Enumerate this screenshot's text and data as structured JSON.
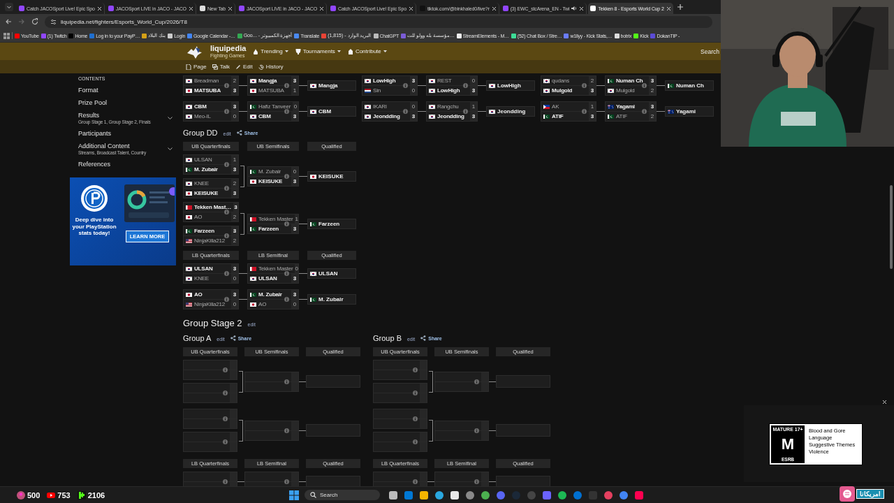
{
  "browser": {
    "tabs": [
      {
        "title": "Catch JACOSport Live! Epic Spo",
        "color": "#9146ff",
        "selected": false,
        "audio": false
      },
      {
        "title": "JACOSport LIVE in JACO - JACO",
        "color": "#9146ff",
        "selected": false,
        "audio": false
      },
      {
        "title": "New Tab",
        "color": "#dddddd",
        "selected": false,
        "audio": false
      },
      {
        "title": "JACOSport LIVE in JACO - JACO",
        "color": "#9146ff",
        "selected": false,
        "audio": false
      },
      {
        "title": "Catch JACOSport Live! Epic Spo",
        "color": "#9146ff",
        "selected": false,
        "audio": false
      },
      {
        "title": "tiktok.com/@binkhaled0/live?r",
        "color": "#111111",
        "selected": false,
        "audio": false
      },
      {
        "title": "(3) EWC_stcArena_EN - Twi",
        "color": "#9146ff",
        "selected": false,
        "audio": true
      },
      {
        "title": "Tekken 8 - Esports World Cup 2",
        "color": "#ffffff",
        "selected": true,
        "audio": false
      }
    ],
    "url": "liquipedia.net/fighters/Esports_World_Cup/2026/T8",
    "bookmarks": [
      {
        "label": "YouTube",
        "color": "#ff0000"
      },
      {
        "label": "(1) Twitch",
        "color": "#9146ff"
      },
      {
        "label": "Home",
        "color": "#000000"
      },
      {
        "label": "Log in to your PayP…",
        "color": "#1f6fd0"
      },
      {
        "label": "بنك البلاد",
        "color": "#d4a017"
      },
      {
        "label": "Login",
        "color": "#cccccc"
      },
      {
        "label": "Google Calendar -…",
        "color": "#4285f4"
      },
      {
        "label": "Goo… - أجهزة الكمبيوتر",
        "color": "#34a853"
      },
      {
        "label": "Translate",
        "color": "#4a8af4"
      },
      {
        "label": "(1,815) - البريد الوارد",
        "color": "#ea4335"
      },
      {
        "label": "ChatGPT",
        "color": "#bbbbbb"
      },
      {
        "label": "مؤسسة بله وولو للت…",
        "color": "#7b5cd6"
      },
      {
        "label": "StreamElements - M…",
        "color": "#eeeeee"
      },
      {
        "label": "(52) Chat Box / Stre…",
        "color": "#3ddc97"
      },
      {
        "label": "w1llyy - Kick Stats,…",
        "color": "#6a7cff"
      },
      {
        "label": "botrix",
        "color": "#dddddd"
      },
      {
        "label": "Kick",
        "color": "#53fc18"
      },
      {
        "label": "DokanTIP -",
        "color": "#5b4bd6"
      }
    ]
  },
  "site": {
    "logo": "liquipedia",
    "subtitle": "Fighting Games",
    "nav": [
      "Trending",
      "Tournaments",
      "Contribute"
    ],
    "search": "Search",
    "actions": [
      "Page",
      "Talk",
      "Edit",
      "History"
    ]
  },
  "sidebar": {
    "heading": "CONTENTS",
    "items": [
      {
        "label": "Format",
        "collapsible": false
      },
      {
        "label": "Prize Pool",
        "collapsible": false
      },
      {
        "label": "Results",
        "sub": "Group Stage 1, Group Stage 2, Finals",
        "collapsible": true
      },
      {
        "label": "Participants",
        "collapsible": false
      },
      {
        "label": "Additional Content",
        "sub": "Streams, Broadcast Talent, Country",
        "collapsible": true
      },
      {
        "label": "References",
        "collapsible": false
      }
    ]
  },
  "ad": {
    "headline": "Deep dive into your PlayStation stats today!",
    "button": "LEARN MORE"
  },
  "top_groups": [
    {
      "blocks": [
        {
          "qf": [
            {
              "players": [
                {
                  "name": "Breadman",
                  "kind": "kr",
                  "score": "2",
                  "winner": false
                },
                {
                  "name": "MATSUBA",
                  "kind": "jp",
                  "score": "3",
                  "winner": true
                }
              ]
            }
          ],
          "sf": {
            "players": [
              {
                "name": "Mangja",
                "kind": "kr",
                "score": "3",
                "winner": true
              },
              {
                "name": "MATSUBA",
                "kind": "jp",
                "score": "1",
                "winner": false
              }
            ]
          },
          "qualified": {
            "name": "Mangja",
            "kind": "kr"
          }
        },
        {
          "qf": [
            {
              "players": [
                {
                  "name": "CBM",
                  "kind": "kr",
                  "score": "3",
                  "winner": true
                },
                {
                  "name": "Meo-IL",
                  "kind": "kr",
                  "score": "0",
                  "winner": false
                }
              ]
            }
          ],
          "sf": {
            "players": [
              {
                "name": "Hafiz Tanveer",
                "kind": "pk",
                "score": "0",
                "winner": false
              },
              {
                "name": "CBM",
                "kind": "kr",
                "score": "3",
                "winner": true
              }
            ]
          },
          "qualified": {
            "name": "CBM",
            "kind": "kr"
          }
        }
      ]
    },
    {
      "blocks": [
        {
          "qf": [
            {
              "players": [
                {
                  "name": "LowHigh",
                  "kind": "kr",
                  "score": "3",
                  "winner": true
                },
                {
                  "name": "Sin",
                  "kind": "nl",
                  "score": "0",
                  "winner": false
                }
              ]
            }
          ],
          "sf": {
            "players": [
              {
                "name": "REST",
                "kind": "kr",
                "score": "0",
                "winner": false
              },
              {
                "name": "LowHigh",
                "kind": "kr",
                "score": "3",
                "winner": true
              }
            ]
          },
          "qualified": {
            "name": "LowHigh",
            "kind": "kr"
          }
        },
        {
          "qf": [
            {
              "players": [
                {
                  "name": "IKARI",
                  "kind": "kr",
                  "score": "0",
                  "winner": false
                },
                {
                  "name": "Jeondding",
                  "kind": "kr",
                  "score": "3",
                  "winner": true
                }
              ]
            }
          ],
          "sf": {
            "players": [
              {
                "name": "Rangchu",
                "kind": "kr",
                "score": "1",
                "winner": false
              },
              {
                "name": "Jeondding",
                "kind": "kr",
                "score": "3",
                "winner": true
              }
            ]
          },
          "qualified": {
            "name": "Jeondding",
            "kind": "kr"
          }
        }
      ]
    },
    {
      "blocks": [
        {
          "qf": [
            {
              "players": [
                {
                  "name": "qudans",
                  "kind": "kr",
                  "score": "2",
                  "winner": false
                },
                {
                  "name": "Mulgold",
                  "kind": "kr",
                  "score": "3",
                  "winner": true
                }
              ]
            }
          ],
          "sf": {
            "players": [
              {
                "name": "Numan Ch",
                "kind": "pk",
                "score": "3",
                "winner": true
              },
              {
                "name": "Mulgold",
                "kind": "kr",
                "score": "2",
                "winner": false
              }
            ]
          },
          "qualified": {
            "name": "Numan Ch",
            "kind": "pk"
          }
        },
        {
          "qf": [
            {
              "players": [
                {
                  "name": "AK",
                  "kind": "ph",
                  "score": "1",
                  "winner": false
                },
                {
                  "name": "ATIF",
                  "kind": "pk",
                  "score": "3",
                  "winner": true
                }
              ]
            }
          ],
          "sf": {
            "players": [
              {
                "name": "Yagami",
                "kind": "au",
                "score": "3",
                "winner": true
              },
              {
                "name": "ATIF",
                "kind": "pk",
                "score": "2",
                "winner": false
              }
            ]
          },
          "qualified": {
            "name": "Yagami",
            "kind": "au"
          }
        }
      ]
    }
  ],
  "group_dd": {
    "title": "Group DD",
    "edit": "edit",
    "share": "Share",
    "kind": "filled",
    "ub_headers": [
      "UB Quarterfinals",
      "UB Semifinals",
      "Qualified"
    ],
    "ub": [
      {
        "qf": [
          {
            "players": [
              {
                "name": "ULSAN",
                "kind": "kr",
                "score": "1",
                "winner": false
              },
              {
                "name": "M. Zubair",
                "kind": "pk",
                "score": "3",
                "winner": true
              }
            ]
          },
          {
            "players": [
              {
                "name": "KNEE",
                "kind": "kr",
                "score": "2",
                "winner": false
              },
              {
                "name": "KEISUKE",
                "kind": "jp",
                "score": "3",
                "winner": true
              }
            ]
          }
        ],
        "sf": {
          "players": [
            {
              "name": "M. Zubair",
              "kind": "pk",
              "score": "0",
              "winner": false
            },
            {
              "name": "KEISUKE",
              "kind": "jp",
              "score": "3",
              "winner": true
            }
          ]
        },
        "qualified": {
          "name": "KEISUKE",
          "kind": "jp"
        }
      },
      {
        "qf": [
          {
            "players": [
              {
                "name": "Tekken Mast…",
                "kind": "bh",
                "score": "3",
                "winner": true
              },
              {
                "name": "AO",
                "kind": "jp",
                "score": "2",
                "winner": false
              }
            ]
          },
          {
            "players": [
              {
                "name": "Farzeen",
                "kind": "pk",
                "score": "3",
                "winner": true
              },
              {
                "name": "NinjaKilla212",
                "kind": "us",
                "score": "2",
                "winner": false
              }
            ]
          }
        ],
        "sf": {
          "players": [
            {
              "name": "Tekken Master",
              "kind": "bh",
              "score": "1",
              "winner": false
            },
            {
              "name": "Farzeen",
              "kind": "pk",
              "score": "3",
              "winner": true
            }
          ]
        },
        "qualified": {
          "name": "Farzeen",
          "kind": "pk"
        }
      }
    ],
    "lb_headers": [
      "LB Quarterfinals",
      "LB Semifinal",
      "Qualified"
    ],
    "lb": [
      {
        "qf": [
          {
            "players": [
              {
                "name": "ULSAN",
                "kind": "kr",
                "score": "3",
                "winner": true
              },
              {
                "name": "KNEE",
                "kind": "kr",
                "score": "0",
                "winner": false
              }
            ]
          }
        ],
        "sf": {
          "players": [
            {
              "name": "Tekken Master",
              "kind": "bh",
              "score": "0",
              "winner": false
            },
            {
              "name": "ULSAN",
              "kind": "kr",
              "score": "3",
              "winner": true
            }
          ]
        },
        "qualified": {
          "name": "ULSAN",
          "kind": "kr"
        }
      },
      {
        "qf": [
          {
            "players": [
              {
                "name": "AO",
                "kind": "jp",
                "score": "3",
                "winner": true
              },
              {
                "name": "NinjaKilla212",
                "kind": "us",
                "score": "0",
                "winner": false
              }
            ]
          }
        ],
        "sf": {
          "players": [
            {
              "name": "M. Zubair",
              "kind": "pk",
              "score": "3",
              "winner": true
            },
            {
              "name": "AO",
              "kind": "jp",
              "score": "0",
              "winner": false
            }
          ]
        },
        "qualified": {
          "name": "M. Zubair",
          "kind": "pk"
        }
      }
    ]
  },
  "stage2": {
    "title": "Group Stage 2",
    "edit": "edit",
    "groups": [
      {
        "title": "Group A",
        "edit": "edit",
        "share": "Share",
        "kind": "empty",
        "ub_headers": [
          "UB Quarterfinals",
          "UB Semifinals",
          "Qualified"
        ],
        "lb_headers": [
          "LB Quarterfinals",
          "LB Semifinal",
          "Qualified"
        ]
      },
      {
        "title": "Group B",
        "edit": "edit",
        "share": "Share",
        "kind": "empty",
        "ub_headers": [
          "UB Quarterfinals",
          "UB Semifinals",
          "Qualified"
        ],
        "lb_headers": [
          "LB Quarterfinals",
          "LB Semifinal",
          "Qualified"
        ]
      }
    ]
  },
  "esrb": {
    "rating": "MATURE 17+",
    "letter": "M",
    "brand": "ESRB",
    "descriptors": [
      "Blood and Gore",
      "Language",
      "Suggestive Themes",
      "Violence"
    ]
  },
  "taskbar": {
    "stats": [
      {
        "kind": "viewers",
        "value": "500"
      },
      {
        "kind": "youtube",
        "value": "753"
      },
      {
        "kind": "kick",
        "value": "2106"
      }
    ],
    "search": "Search",
    "logo_text": "امريكانا"
  }
}
